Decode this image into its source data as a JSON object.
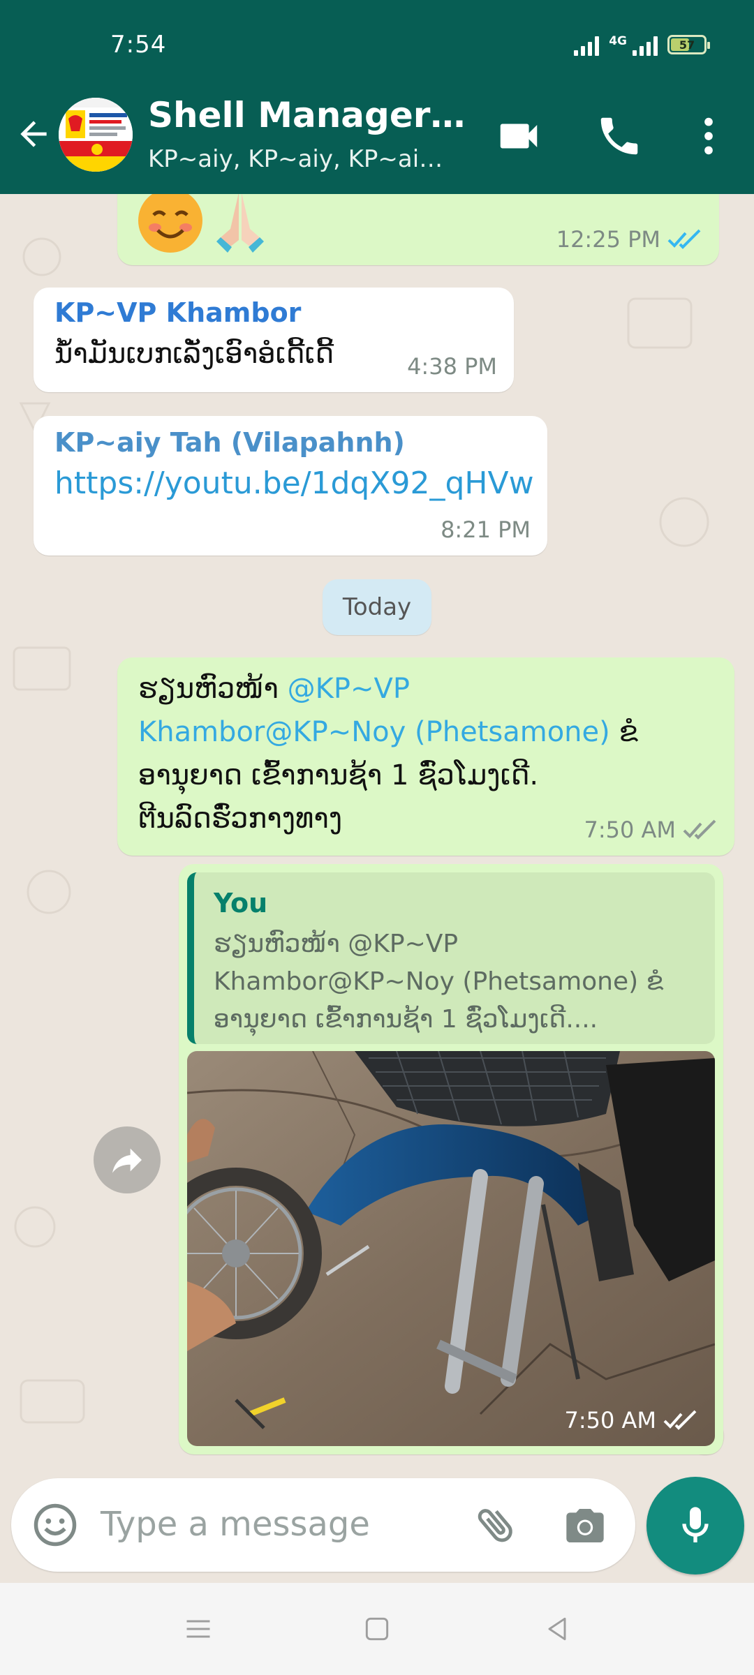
{
  "status_bar": {
    "time": "7:54",
    "network": "4G",
    "battery_level": "57",
    "battery_percent": 57
  },
  "header": {
    "title": "Shell Manager Te...",
    "subtitle": "KP~aiy, KP~aiy, KP~aiy,..."
  },
  "messages": [
    {
      "type": "outgoing",
      "time": "12:25 PM",
      "status": "read"
    },
    {
      "type": "incoming",
      "sender": "KP~VP Khambor",
      "sender_color": "#2f7bd4",
      "text": "ນ້ຳມັນເບກເລັ່ງເອົາອໍເດີ້ເດີ້",
      "time": "4:38 PM"
    },
    {
      "type": "incoming",
      "sender": "KP~aiy Tah (Vilapahnh)",
      "sender_color": "#4a90c9",
      "text": "https://youtu.be/1dqX92_qHVw",
      "time": "8:21 PM"
    },
    {
      "type": "outgoing",
      "text_start": "ຮຽນຫົວໜ້າ ",
      "mention_1": "@KP~VP",
      "mention_2": "Khambor@KP~Noy (Phetsamone)",
      "text_end_1": " ຂໍ",
      "line_3": "ອານຸຍາດ ເຂົ້າການຊ້າ 1 ຊົ່ວໂມງເດີ.",
      "line_4": "ຕີນລົດຮົ່ວກາງທາງ",
      "time": "7:50 AM",
      "status": "delivered"
    },
    {
      "type": "outgoing_reply",
      "quoted_author": "You",
      "quoted_line_1": "ຮຽນຫົວໜ້າ @KP~VP",
      "quoted_line_2": "Khambor@KP~Noy (Phetsamone) ຂໍ",
      "quoted_line_3": "ອານຸຍາດ ເຂົ້າການຊ້າ 1 ຊົ່ວໂມງເດີ....",
      "time": "7:50 AM",
      "status": "delivered"
    }
  ],
  "date_divider": "Today",
  "composer": {
    "placeholder": "Type a message"
  },
  "colors": {
    "header": "#075e54",
    "outgoing": "#dcf8c6",
    "incoming": "#ffffff",
    "accent": "#128c7e",
    "read_tick": "#34b7f1"
  },
  "icons": [
    "back-arrow-icon",
    "video-call-icon",
    "phone-icon",
    "more-vert-icon",
    "emoji-icon",
    "attach-icon",
    "camera-icon",
    "mic-icon",
    "forward-icon",
    "menu-nav-icon",
    "home-nav-icon",
    "back-nav-icon"
  ]
}
